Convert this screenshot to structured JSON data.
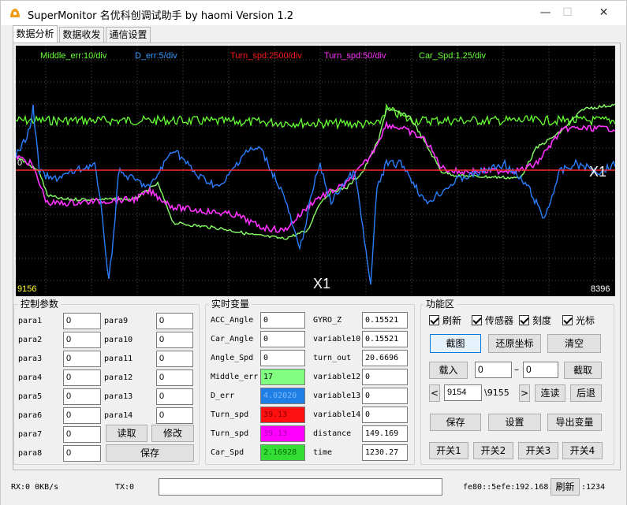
{
  "window": {
    "title": "SuperMonitor 名优科创调试助手 by haomi   Version 1.2",
    "minimize": "—",
    "maximize": "☐",
    "close": "✕"
  },
  "tabs": [
    "数据分析",
    "数据收发",
    "通信设置"
  ],
  "scope": {
    "legend": [
      {
        "text": "Middle_err:10/div",
        "color": "#66ff33"
      },
      {
        "text": "D_err:5/div",
        "color": "#3399ff"
      },
      {
        "text": "Turn_spd:2500/div",
        "color": "#ff1a1a"
      },
      {
        "text": "Turn_spd:50/div",
        "color": "#ff33ff"
      },
      {
        "text": "Car_Spd:1.25/div",
        "color": "#66ff33"
      }
    ],
    "zero_label": "0",
    "x_left": "9156",
    "x_right": "8396",
    "cursor_label_bottom": "X1",
    "cursor_label_right": "X1"
  },
  "control_params": {
    "title": "控制参数",
    "left": [
      {
        "label": "para1",
        "value": "0"
      },
      {
        "label": "para2",
        "value": "0"
      },
      {
        "label": "para3",
        "value": "0"
      },
      {
        "label": "para4",
        "value": "0"
      },
      {
        "label": "para5",
        "value": "0"
      },
      {
        "label": "para6",
        "value": "0"
      },
      {
        "label": "para7",
        "value": "0"
      },
      {
        "label": "para8",
        "value": "0"
      }
    ],
    "right": [
      {
        "label": "para9",
        "value": "0"
      },
      {
        "label": "para10",
        "value": "0"
      },
      {
        "label": "para11",
        "value": "0"
      },
      {
        "label": "para12",
        "value": "0"
      },
      {
        "label": "para13",
        "value": "0"
      },
      {
        "label": "para14",
        "value": "0"
      }
    ],
    "read_button": "读取",
    "modify_button": "修改",
    "save_button": "保存"
  },
  "realtime": {
    "title": "实时变量",
    "left": [
      {
        "label": "ACC_Angle",
        "value": "0",
        "bg": "#ffffff",
        "fg": "#000000"
      },
      {
        "label": "Car_Angle",
        "value": "0",
        "bg": "#ffffff",
        "fg": "#000000"
      },
      {
        "label": "Angle_Spd",
        "value": "0",
        "bg": "#ffffff",
        "fg": "#000000"
      },
      {
        "label": "Middle_err",
        "value": "17",
        "bg": "#80ff80",
        "fg": "#000000"
      },
      {
        "label": "D_err",
        "value": "4.02020",
        "bg": "#1e7fe6",
        "fg": "#7fb8f5"
      },
      {
        "label": "Turn_spd",
        "value": "39.13",
        "bg": "#ff1010",
        "fg": "#8a0000"
      },
      {
        "label": "Turn_spd",
        "value": "39.13",
        "bg": "#ff00ff",
        "fg": "#b000b0"
      },
      {
        "label": "Car_Spd",
        "value": "2.16928",
        "bg": "#33dd33",
        "fg": "#0a6a0a"
      }
    ],
    "right": [
      {
        "label": "GYRO_Z",
        "value": "0.15521"
      },
      {
        "label": "variable10",
        "value": "0.15521"
      },
      {
        "label": "turn_out",
        "value": "20.6696"
      },
      {
        "label": "variable12",
        "value": "0"
      },
      {
        "label": "variable13",
        "value": "0"
      },
      {
        "label": "variable14",
        "value": "0"
      },
      {
        "label": "distance",
        "value": "149.169"
      },
      {
        "label": "time",
        "value": "1230.27"
      }
    ]
  },
  "functions": {
    "title": "功能区",
    "checkboxes": [
      "刷新",
      "传感器",
      "刻度",
      "光标"
    ],
    "screenshot_button": "截图",
    "restore_button": "还原坐标",
    "clear_button": "清空",
    "load_button": "载入",
    "range_from": "0",
    "range_dash": "–",
    "range_to": "0",
    "cut_button": "截取",
    "prev_button": "<",
    "frame_value": "9154",
    "frame_total": "\\9155",
    "next_button": ">",
    "continuous_button": "连读",
    "back_button": "后退",
    "save_button": "保存",
    "settings_button": "设置",
    "export_button": "导出变量",
    "switches": [
      "开关1",
      "开关2",
      "开关3",
      "开关4"
    ]
  },
  "status": {
    "rx": "RX:0 0KB/s",
    "tx": "TX:0",
    "ip": "fe80::5efe:192.168.",
    "refresh_button": "刷新",
    "port": ":1234"
  }
}
